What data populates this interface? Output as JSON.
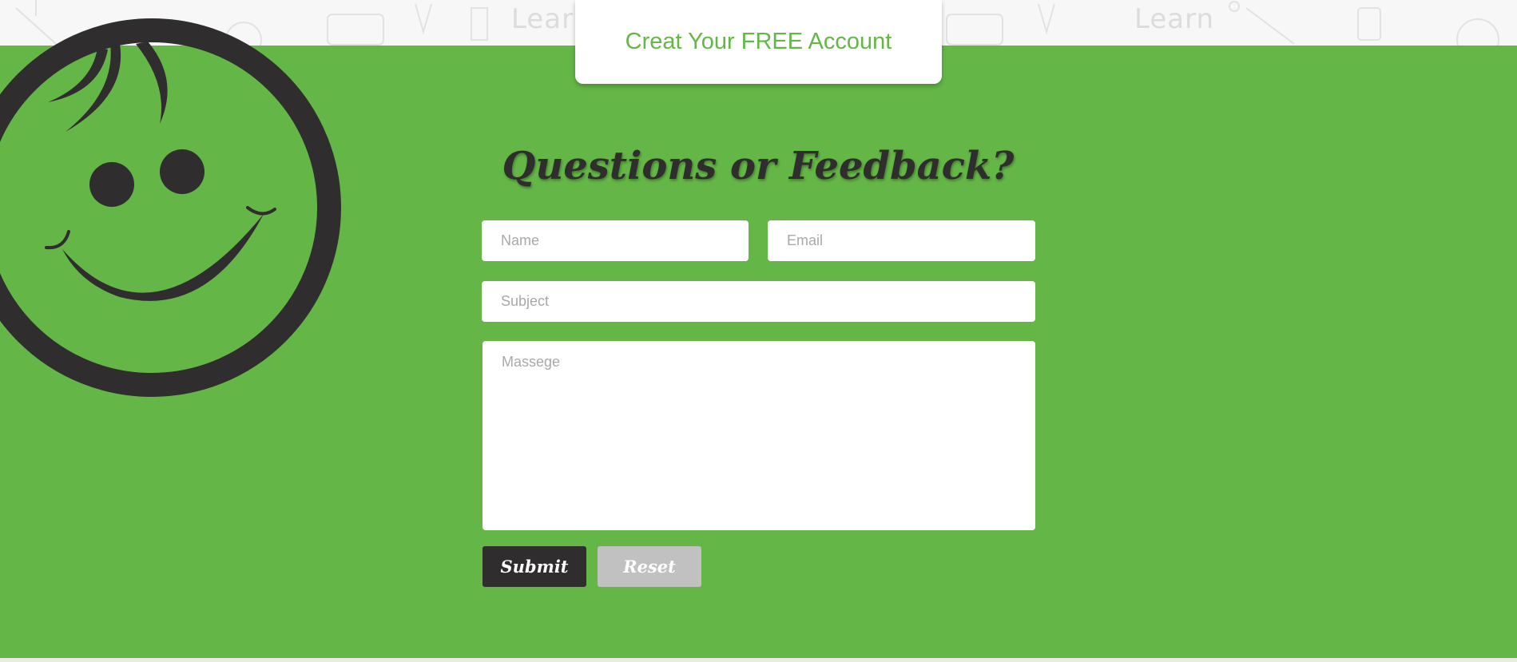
{
  "colors": {
    "brand_green": "#64b746",
    "dark": "#2f2d2e",
    "reset_gray": "#c1c1c1",
    "white": "#ffffff"
  },
  "decor": {
    "doodle_words": [
      "Learn",
      "Learn"
    ],
    "mascot": "smiley-face-icon"
  },
  "header": {
    "account_button_label": "Creat Your FREE Account"
  },
  "contact": {
    "title": "Questions or Feedback?",
    "fields": {
      "name_placeholder": "Name",
      "email_placeholder": "Email",
      "subject_placeholder": "Subject",
      "message_placeholder": "Massege"
    },
    "buttons": {
      "submit_label": "Submit",
      "reset_label": "Reset"
    }
  }
}
